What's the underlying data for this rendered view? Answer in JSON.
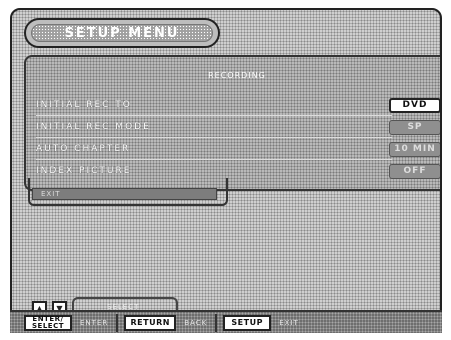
{
  "title": "SETUP MENU",
  "window_header": "RECORDING",
  "rows": [
    {
      "label": "INITIAL REC TO",
      "value": "DVD",
      "state": "active"
    },
    {
      "label": "INITIAL REC MODE",
      "value": "SP",
      "state": "dim"
    },
    {
      "label": "AUTO CHAPTER",
      "value": "10 MIN",
      "state": "dim"
    },
    {
      "label": "INDEX PICTURE",
      "value": "OFF",
      "state": "dim"
    }
  ],
  "exit_label": "EXIT",
  "nav": {
    "up_icon": "up-arrow-icon",
    "down_icon": "down-arrow-icon",
    "select_text": "SELECT"
  },
  "buttons": [
    {
      "key_line1": "ENTER/",
      "key_line2": "SELECT",
      "desc": "ENTER"
    },
    {
      "key": "RETURN",
      "desc": "BACK"
    },
    {
      "key": "SETUP",
      "desc": "EXIT"
    }
  ]
}
